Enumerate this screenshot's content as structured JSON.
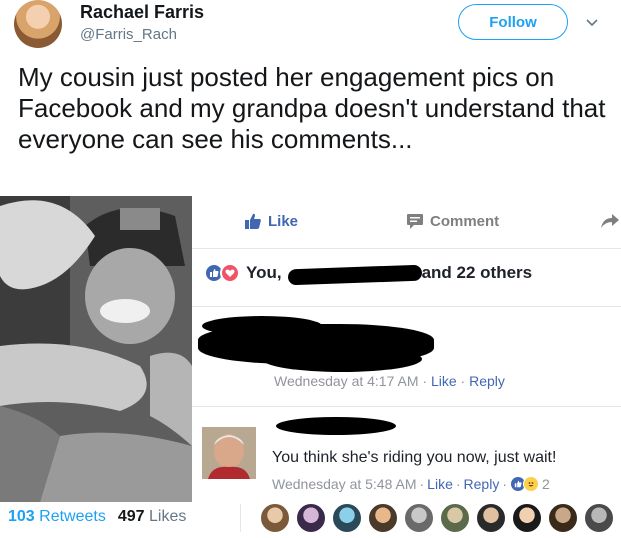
{
  "user": {
    "name": "Rachael Farris",
    "handle": "@Farris_Rach",
    "follow_label": "Follow"
  },
  "tweet": {
    "text": "My cousin just posted her engagement pics on Facebook and my grandpa doesn't understand that everyone can see his comments..."
  },
  "facebook": {
    "actions": {
      "like": "Like",
      "comment": "Comment"
    },
    "reactions": {
      "you_label": "You,",
      "others_label": "and 22 others"
    },
    "comment1": {
      "time": "Wednesday at 4:17 AM",
      "sep1": "·",
      "like": "Like",
      "sep2": "·",
      "reply": "Reply"
    },
    "comment2": {
      "text": "You think she's riding you now, just wait!",
      "time": "Wednesday at 5:48 AM",
      "sep1": "·",
      "like": "Like",
      "sep2": "·",
      "reply": "Reply",
      "sep3": "·",
      "reaction_count": "2"
    }
  },
  "stats": {
    "retweets_count": "103",
    "retweets_label": "Retweets",
    "likes_count": "497",
    "likes_label": "Likes"
  },
  "colors": {
    "twitter_blue": "#1da1f2",
    "facebook_blue": "#4267b2",
    "meta_gray": "#90949c"
  }
}
